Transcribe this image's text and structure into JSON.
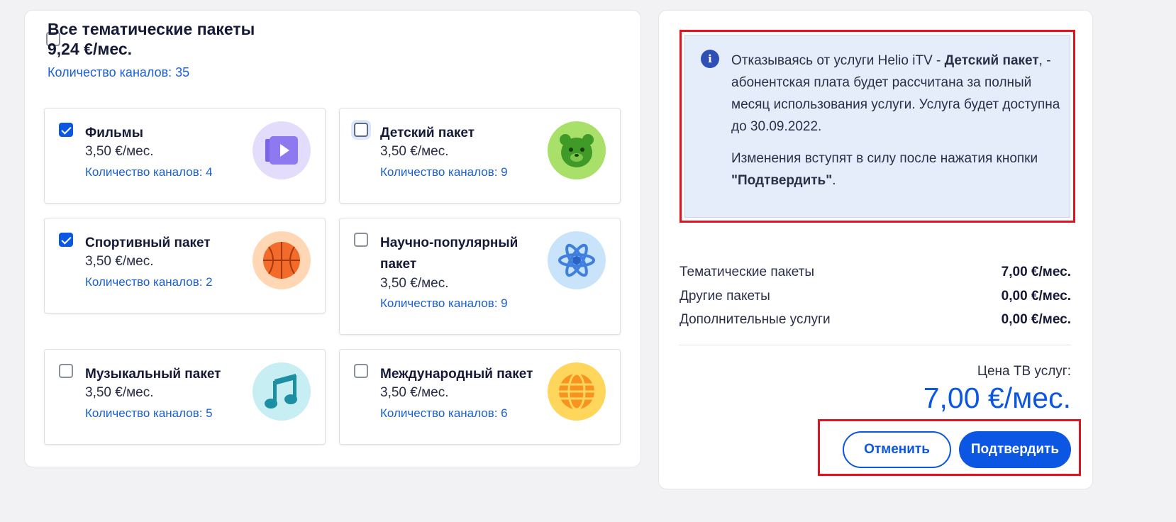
{
  "all_packages": {
    "title": "Все тематические пакеты",
    "price": "9,24 €/мес.",
    "count": "Количество каналов: 35",
    "checked": false
  },
  "packages": [
    {
      "name": "Фильмы",
      "price": "3,50 €/мес.",
      "count": "Количество каналов: 4",
      "checked": true,
      "icon": "video-play-icon",
      "icon_bg": "#e4dcfb"
    },
    {
      "name": "Детский пакет",
      "price": "3,50 €/мес.",
      "count": "Количество каналов: 9",
      "checked": false,
      "icon": "bear-icon",
      "icon_bg": "#a9e06a"
    },
    {
      "name": "Спортивный пакет",
      "price": "3,50 €/мес.",
      "count": "Количество каналов: 2",
      "checked": true,
      "icon": "basketball-icon",
      "icon_bg": "#ffd7b5"
    },
    {
      "name": "Научно-популярный пакет",
      "price": "3,50 €/мес.",
      "count": "Количество каналов: 9",
      "checked": false,
      "icon": "atom-icon",
      "icon_bg": "#c9e3fb"
    },
    {
      "name": "Музыкальный пакет",
      "price": "3,50 €/мес.",
      "count": "Количество каналов: 5",
      "checked": false,
      "icon": "music-note-icon",
      "icon_bg": "#c7eef2"
    },
    {
      "name": "Международный пакет",
      "price": "3,50 €/мес.",
      "count": "Количество каналов: 6",
      "checked": false,
      "icon": "globe-icon",
      "icon_bg": "#ffd65c"
    }
  ],
  "info": {
    "p1_a": "Отказываясь от услуги Helio iTV - ",
    "p1_b": "Детский пакет",
    "p1_c": ", - абонентская плата будет рассчитана за полный месяц использования услуги. Услуга будет доступна до 30.09.2022.",
    "p2_a": "Изменения вступят в силу после нажатия кнопки ",
    "p2_b": "\"Подтвердить\"",
    "p2_c": "."
  },
  "summary": [
    {
      "label": "Тематические пакеты",
      "value": "7,00 €/мес."
    },
    {
      "label": "Другие пакеты",
      "value": "0,00 €/мес."
    },
    {
      "label": "Дополнительные услуги",
      "value": "0,00 €/мес."
    }
  ],
  "total": {
    "label": "Цена ТВ услуг:",
    "value": "7,00 €/мес."
  },
  "buttons": {
    "cancel": "Отменить",
    "confirm": "Подтвердить"
  },
  "colors": {
    "accent": "#0b57e3",
    "highlight": "#e3121e",
    "info_bg": "#e5edfb"
  }
}
